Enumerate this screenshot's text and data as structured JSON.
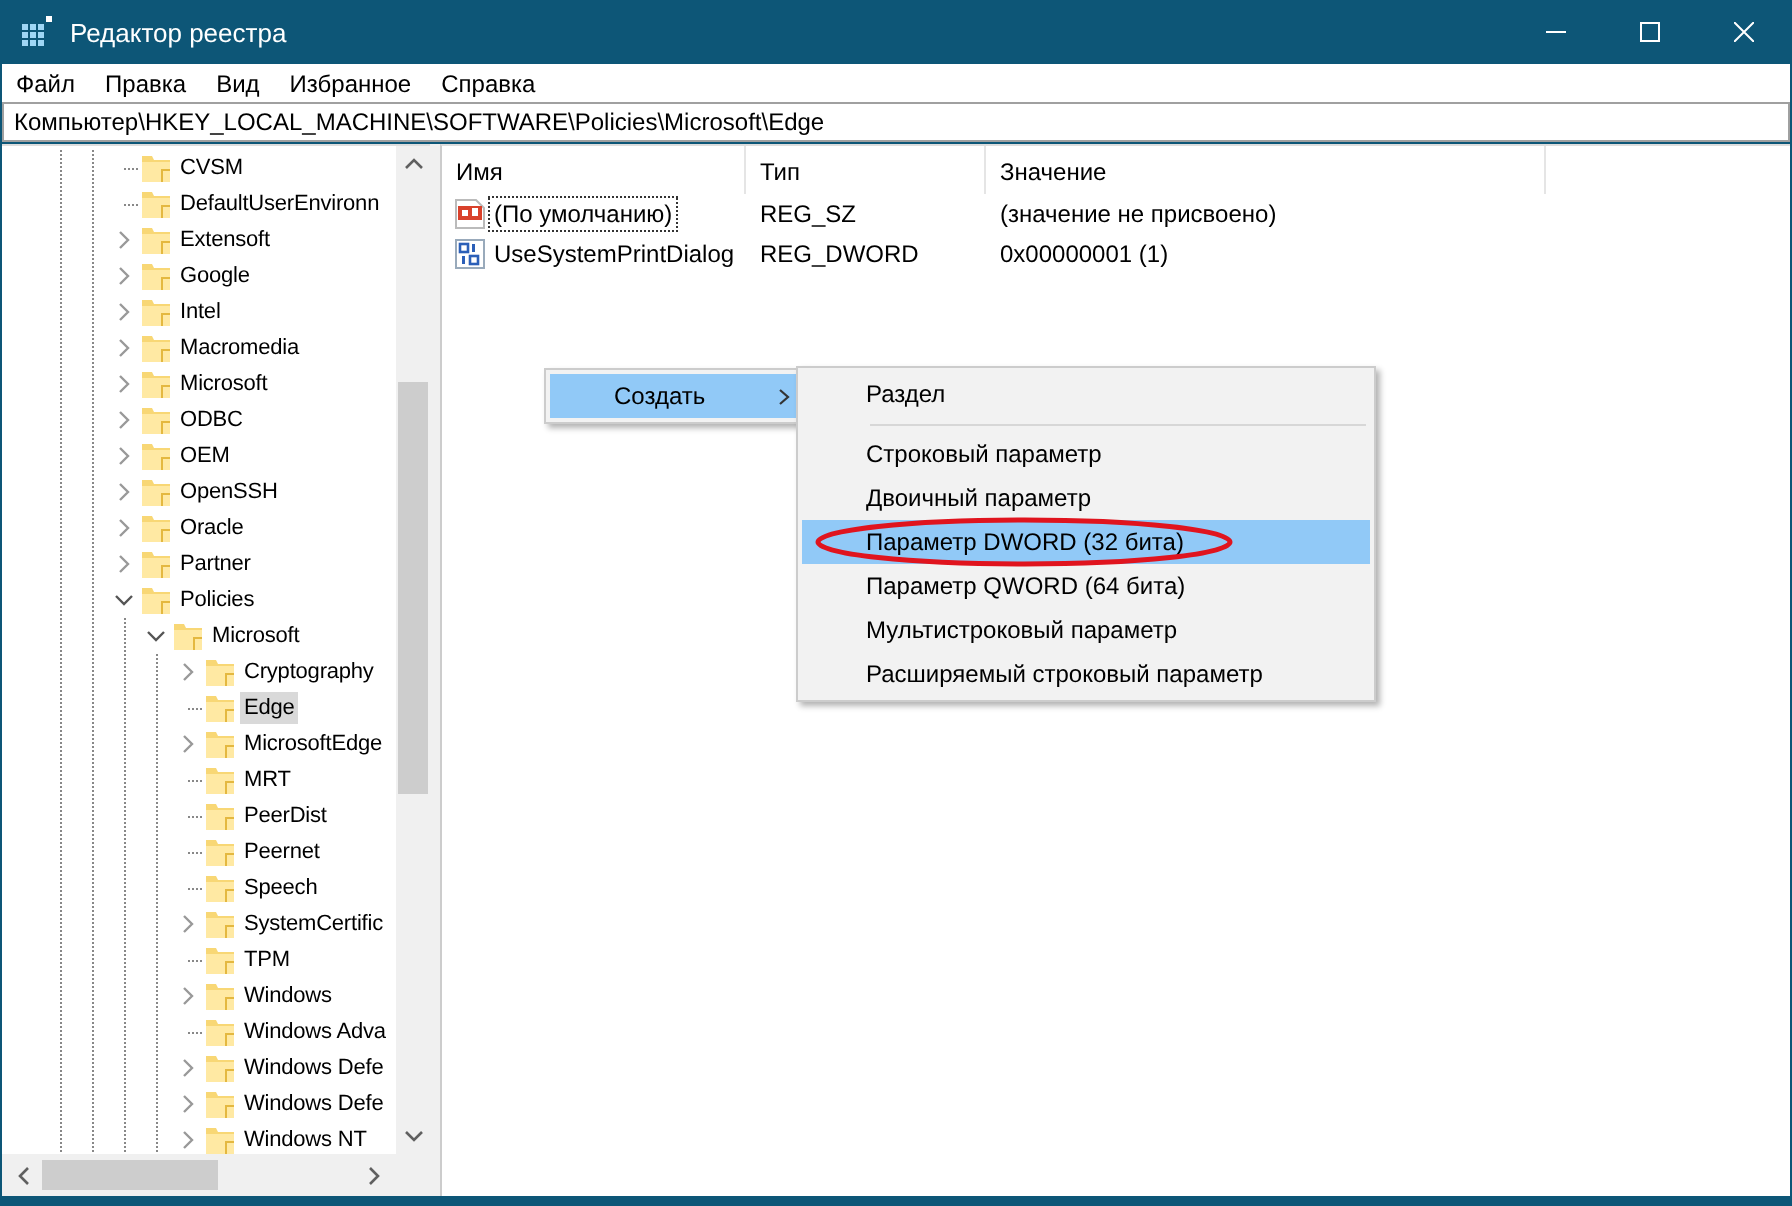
{
  "window": {
    "title": "Редактор реестра"
  },
  "menu_bar": [
    "Файл",
    "Правка",
    "Вид",
    "Избранное",
    "Справка"
  ],
  "address_bar": {
    "value": "Компьютер\\HKEY_LOCAL_MACHINE\\SOFTWARE\\Policies\\Microsoft\\Edge"
  },
  "tree": [
    {
      "label": "CVSM",
      "kind": "leaf",
      "selected": false
    },
    {
      "label": "DefaultUserEnvironn",
      "kind": "leaf",
      "selected": false
    },
    {
      "label": "Extensoft",
      "kind": "branch",
      "expanded": false,
      "selected": false
    },
    {
      "label": "Google",
      "kind": "branch",
      "expanded": false,
      "selected": false
    },
    {
      "label": "Intel",
      "kind": "branch",
      "expanded": false,
      "selected": false
    },
    {
      "label": "Macromedia",
      "kind": "branch",
      "expanded": false,
      "selected": false
    },
    {
      "label": "Microsoft",
      "kind": "branch",
      "expanded": false,
      "selected": false
    },
    {
      "label": "ODBC",
      "kind": "branch",
      "expanded": false,
      "selected": false
    },
    {
      "label": "OEM",
      "kind": "branch",
      "expanded": false,
      "selected": false
    },
    {
      "label": "OpenSSH",
      "kind": "branch",
      "expanded": false,
      "selected": false
    },
    {
      "label": "Oracle",
      "kind": "branch",
      "expanded": false,
      "selected": false
    },
    {
      "label": "Partner",
      "kind": "branch",
      "expanded": false,
      "selected": false
    },
    {
      "label": "Policies",
      "kind": "branch",
      "expanded": true,
      "selected": false,
      "children": [
        {
          "label": "Microsoft",
          "kind": "branch",
          "expanded": true,
          "selected": false,
          "children": [
            {
              "label": "Cryptography",
              "kind": "branch",
              "expanded": false,
              "selected": false
            },
            {
              "label": "Edge",
              "kind": "leaf",
              "selected": true
            },
            {
              "label": "MicrosoftEdge",
              "kind": "branch",
              "expanded": false,
              "selected": false
            },
            {
              "label": "MRT",
              "kind": "leaf",
              "selected": false
            },
            {
              "label": "PeerDist",
              "kind": "leaf",
              "selected": false
            },
            {
              "label": "Peernet",
              "kind": "leaf",
              "selected": false
            },
            {
              "label": "Speech",
              "kind": "leaf",
              "selected": false
            },
            {
              "label": "SystemCertific",
              "kind": "branch",
              "expanded": false,
              "selected": false
            },
            {
              "label": "TPM",
              "kind": "leaf",
              "selected": false
            },
            {
              "label": "Windows",
              "kind": "branch",
              "expanded": false,
              "selected": false
            },
            {
              "label": "Windows Adva",
              "kind": "leaf",
              "selected": false
            },
            {
              "label": "Windows Defe",
              "kind": "branch",
              "expanded": false,
              "selected": false
            },
            {
              "label": "Windows Defe",
              "kind": "branch",
              "expanded": false,
              "selected": false
            },
            {
              "label": "Windows NT",
              "kind": "branch",
              "expanded": false,
              "selected": false
            }
          ]
        }
      ]
    }
  ],
  "table": {
    "columns": [
      "Имя",
      "Тип",
      "Значение"
    ],
    "rows": [
      {
        "kind": "string",
        "name": "(По умолчанию)",
        "type": "REG_SZ",
        "value": "(значение не присвоено)",
        "focused": true
      },
      {
        "kind": "binary",
        "name": "UseSystemPrintDialog",
        "type": "REG_DWORD",
        "value": "0x00000001 (1)",
        "focused": false
      }
    ]
  },
  "context_menu": {
    "items": [
      {
        "label": "Создать",
        "selected": true,
        "submenu": true
      }
    ]
  },
  "submenu": {
    "items": [
      {
        "kind": "item",
        "label": "Раздел",
        "selected": false
      },
      {
        "kind": "separator"
      },
      {
        "kind": "item",
        "label": "Строковый параметр",
        "selected": false
      },
      {
        "kind": "item",
        "label": "Двоичный параметр",
        "selected": false
      },
      {
        "kind": "item",
        "label": "Параметр DWORD (32 бита)",
        "selected": true,
        "circled": true
      },
      {
        "kind": "item",
        "label": "Параметр QWORD (64 бита)",
        "selected": false
      },
      {
        "kind": "item",
        "label": "Мультистроковый параметр",
        "selected": false
      },
      {
        "kind": "item",
        "label": "Расширяемый строковый параметр",
        "selected": false
      }
    ]
  }
}
